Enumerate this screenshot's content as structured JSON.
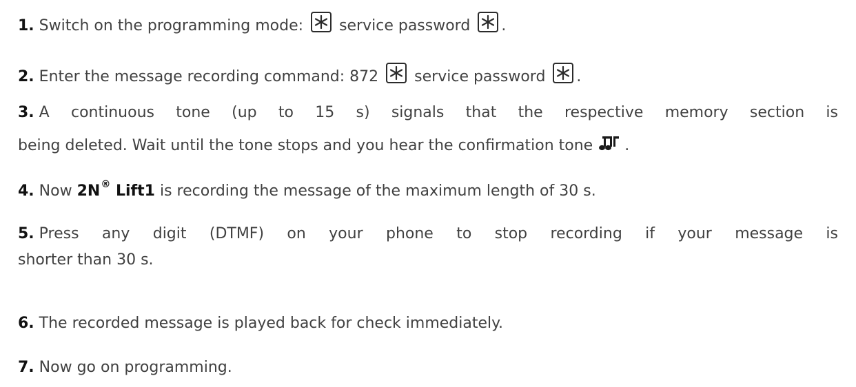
{
  "steps": [
    {
      "number": "1.",
      "text_before": "Switch on the programming mode:",
      "text_middle": "service password",
      "text_after": "."
    },
    {
      "number": "2.",
      "text_before": "Enter the message recording command: 872",
      "text_middle": "service password",
      "text_after": "."
    },
    {
      "number": "3.",
      "text_line1": "A continuous tone (up to 15 s) signals that the respective memory section is",
      "text_line2": "being deleted. Wait until the tone stops and you hear the confirmation tone",
      "text_after": "."
    },
    {
      "number": "4.",
      "text_before": "Now",
      "brand_name": "2N",
      "brand_mark": "®",
      "brand_product": "Lift1",
      "text_after": "is recording the message of the maximum length of 30 s."
    },
    {
      "number": "5.",
      "text_line1": "Press any digit (DTMF) on your phone to stop recording if your message is",
      "text_line2": "shorter than 30 s."
    },
    {
      "number": "6.",
      "text": "The recorded message is played back for check immediately."
    },
    {
      "number": "7.",
      "text": "Now go on programming."
    }
  ],
  "icons": {
    "key": "star-key-icon",
    "tone": "confirmation-tone-icon"
  }
}
